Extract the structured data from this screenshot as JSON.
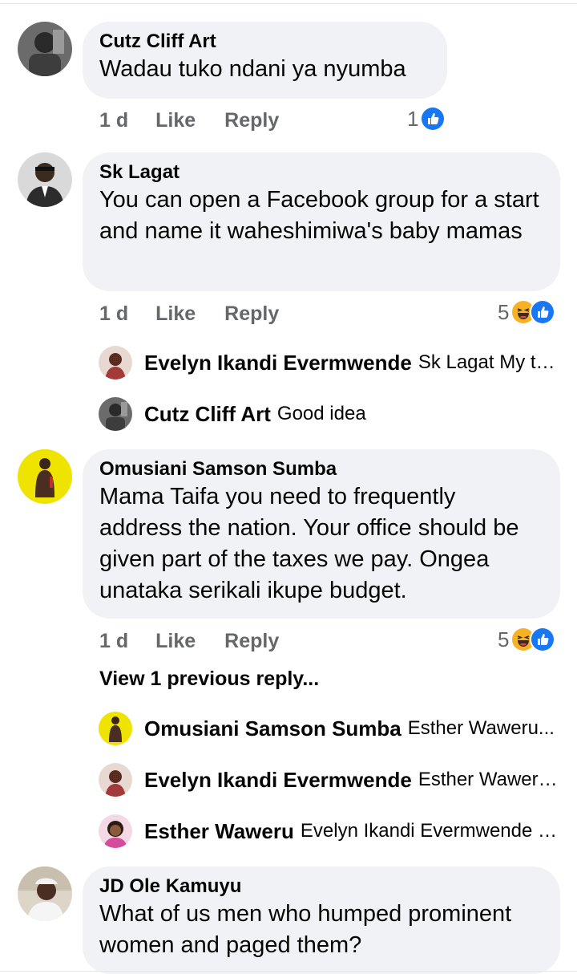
{
  "colors": {
    "bubble": "#f0f2f5",
    "muted": "#65676b",
    "like_blue": "#1877f2",
    "haha_yellow": "#f7b125"
  },
  "comments": [
    {
      "author": "Cutz Cliff Art",
      "text": "Wadau tuko ndani ya nyumba",
      "time": "1 d",
      "like": "Like",
      "reply": "Reply",
      "reaction_count": "1",
      "reaction_icons": [
        "like-icon"
      ]
    },
    {
      "author": "Sk Lagat",
      "text": "You can open a Facebook group for a start and name it waheshimiwa's baby mamas",
      "time": "1 d",
      "like": "Like",
      "reply": "Reply",
      "reaction_count": "5",
      "reaction_icons": [
        "haha-icon",
        "like-icon"
      ],
      "replies": [
        {
          "author": "Evelyn Ikandi Evermwende",
          "text": "Sk Lagat My th..."
        },
        {
          "author": "Cutz Cliff Art",
          "text": "Good idea"
        }
      ]
    },
    {
      "author": "Omusiani Samson Sumba",
      "text": "Mama Taifa you need to frequently address the nation. Your office should be given part of the taxes we pay. Ongea unataka serikali ikupe budget.",
      "time": "1 d",
      "like": "Like",
      "reply": "Reply",
      "reaction_count": "5",
      "reaction_icons": [
        "haha-icon",
        "like-icon"
      ],
      "view_previous": "View 1 previous reply...",
      "replies": [
        {
          "author": "Omusiani Samson Sumba",
          "text": "Esther Waweru..."
        },
        {
          "author": "Evelyn Ikandi Evermwende",
          "text": "Esther Waweru ..."
        },
        {
          "author": "Esther Waweru",
          "text": "Evelyn Ikandi Evermwende it..."
        }
      ]
    },
    {
      "author": "JD Ole Kamuyu",
      "text": "What of us men who humped prominent women and paged them?"
    }
  ]
}
